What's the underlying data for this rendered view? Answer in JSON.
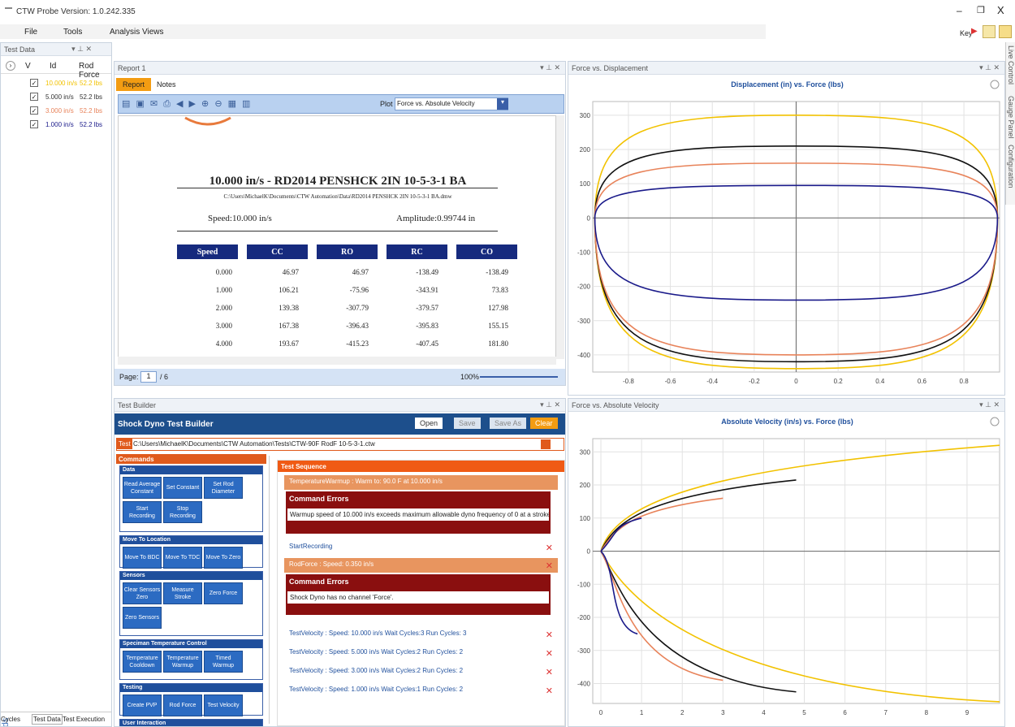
{
  "app": {
    "title": "CTW Probe Version: 1.0.242.335",
    "menu": [
      "File",
      "Tools",
      "Analysis Views"
    ],
    "key_label": "Key"
  },
  "test_data": {
    "title": "Test Data",
    "cols": [
      "V",
      "Id",
      "Rod Force"
    ],
    "rows": [
      {
        "id": "10.000 in/s",
        "force": "52.2 lbs",
        "color": "#f2c200"
      },
      {
        "id": "5.000 in/s",
        "force": "52.2 lbs",
        "color": "#333333"
      },
      {
        "id": "3.000 in/s",
        "force": "52.2 lbs",
        "color": "#e8835a"
      },
      {
        "id": "1.000 in/s",
        "force": "52.2 lbs",
        "color": "#1a1a8a"
      }
    ],
    "fields_label": "Fields",
    "bottom_tabs": [
      "Cycles",
      "Test Data",
      "Test Execution"
    ]
  },
  "report": {
    "title": "Report 1",
    "tabs": [
      "Report",
      "Notes"
    ],
    "plot_label": "Plot",
    "plot_value": "Force vs. Absolute Velocity",
    "heading": "10.000 in/s - RD2014 PENSHCK 2IN 10-5-3-1 BA",
    "path": "C:\\Users\\MichaelK\\Documents\\CTW Automation\\Data\\RD2014 PENSHCK 2IN 10-5-3-1 BA.dmw",
    "speed": "Speed:10.000 in/s",
    "amplitude": "Amplitude:0.99744 in",
    "table": {
      "headers": [
        "Speed",
        "CC",
        "RO",
        "RC",
        "CO"
      ],
      "rows": [
        [
          "0.000",
          "46.97",
          "46.97",
          "-138.49",
          "-138.49"
        ],
        [
          "1.000",
          "106.21",
          "-75.96",
          "-343.91",
          "73.83"
        ],
        [
          "2.000",
          "139.38",
          "-307.79",
          "-379.57",
          "127.98"
        ],
        [
          "3.000",
          "167.38",
          "-396.43",
          "-395.83",
          "155.15"
        ],
        [
          "4.000",
          "193.67",
          "-415.23",
          "-407.45",
          "181.80"
        ]
      ]
    },
    "page_label": "Page:",
    "page": "1",
    "page_total": "/ 6",
    "zoom": "100%"
  },
  "builder": {
    "panel_title": "Test Builder",
    "title": "Shock Dyno Test Builder",
    "open": "Open",
    "save": "Save",
    "save_as": "Save As",
    "clear": "Clear",
    "test_label": "Test",
    "test_path": "C:\\Users\\MichaelK\\Documents\\CTW Automation\\Tests\\CTW-90F RodF 10-5-3-1.ctw",
    "commands_title": "Commands",
    "groups": [
      {
        "name": "Data",
        "buttons": [
          "Read Average Constant",
          "Set Constant",
          "Set Rod Diameter",
          "Start Recording",
          "Stop Recording"
        ]
      },
      {
        "name": "Move To Location",
        "buttons": [
          "Move To BDC",
          "Move To TDC",
          "Move To Zero"
        ]
      },
      {
        "name": "Sensors",
        "buttons": [
          "Clear Sensors Zero",
          "Measure Stroke",
          "Zero Force",
          "Zero Sensors"
        ]
      },
      {
        "name": "Speciman Temperature Control",
        "buttons": [
          "Temperature Cooldown",
          "Temperature Warmup",
          "Timed Warmup"
        ]
      },
      {
        "name": "Testing",
        "buttons": [
          "Create PVP",
          "Rod Force",
          "Test Velocity"
        ]
      },
      {
        "name": "User Interaction",
        "buttons": []
      }
    ],
    "sequence_title": "Test Sequence",
    "seq": {
      "s1": "TemperatureWarmup : Warm to: 90.0 F at 10.000 in/s",
      "err_title": "Command Errors",
      "err1": "Warmup speed of 10.000 in/s exceeds maximum allowable dyno frequency of 0 at a stroke of",
      "s2": "StartRecording",
      "s3": "RodForce : Speed: 0.350 in/s",
      "err2": "Shock Dyno has no channel 'Force'.",
      "s4": "TestVelocity : Speed: 10.000 in/s Wait Cycles:3  Run Cycles: 3",
      "s5": "TestVelocity : Speed: 5.000 in/s Wait Cycles:2  Run Cycles: 2",
      "s6": "TestVelocity : Speed: 3.000 in/s Wait Cycles:2  Run Cycles: 2",
      "s7": "TestVelocity : Speed: 1.000 in/s Wait Cycles:1  Run Cycles: 2"
    }
  },
  "side_tabs": [
    "Live Control",
    "Gauge Panel",
    "Configuration"
  ],
  "chart_data": [
    {
      "panel": "Force vs. Displacement",
      "type": "line",
      "title": "Displacement (in) vs. Force (lbs)",
      "xlim": [
        -0.97,
        0.97
      ],
      "ylim": [
        -450,
        340
      ],
      "xticks": [
        "-0.8",
        "-0.6",
        "-0.4",
        "-0.2",
        "0",
        "0.2",
        "0.4",
        "0.6",
        "0.8"
      ],
      "yticks": [
        "300",
        "200",
        "100",
        "0",
        "-100",
        "-200",
        "-300",
        "-400"
      ],
      "series": [
        {
          "color": "#f2c200",
          "top": 300,
          "bottom": -440
        },
        {
          "color": "#111111",
          "top": 210,
          "bottom": -420
        },
        {
          "color": "#e8835a",
          "top": 160,
          "bottom": -400
        },
        {
          "color": "#1a1a8a",
          "top": 95,
          "bottom": -240
        }
      ]
    },
    {
      "panel": "Force vs. Absolute Velocity",
      "type": "line",
      "title": "Absolute Velocity (in/s) vs. Force (lbs)",
      "xlim": [
        -0.2,
        9.8
      ],
      "ylim": [
        -460,
        340
      ],
      "xticks": [
        "0",
        "1",
        "2",
        "3",
        "4",
        "5",
        "6",
        "7",
        "8",
        "9"
      ],
      "yticks": [
        "300",
        "200",
        "100",
        "0",
        "-100",
        "-200",
        "-300",
        "-400"
      ],
      "series": [
        {
          "color": "#f2c200",
          "ext": [
            [
              9.8,
              320
            ],
            [
              9.8,
              -455
            ]
          ]
        },
        {
          "color": "#111111",
          "ext": [
            [
              4.8,
              215
            ],
            [
              4.8,
              -425
            ]
          ]
        },
        {
          "color": "#e8835a",
          "ext": [
            [
              3.0,
              160
            ],
            [
              3.0,
              -390
            ]
          ]
        },
        {
          "color": "#1a1a8a",
          "ext": [
            [
              1.0,
              100
            ],
            [
              0.9,
              -250
            ]
          ]
        }
      ]
    }
  ]
}
